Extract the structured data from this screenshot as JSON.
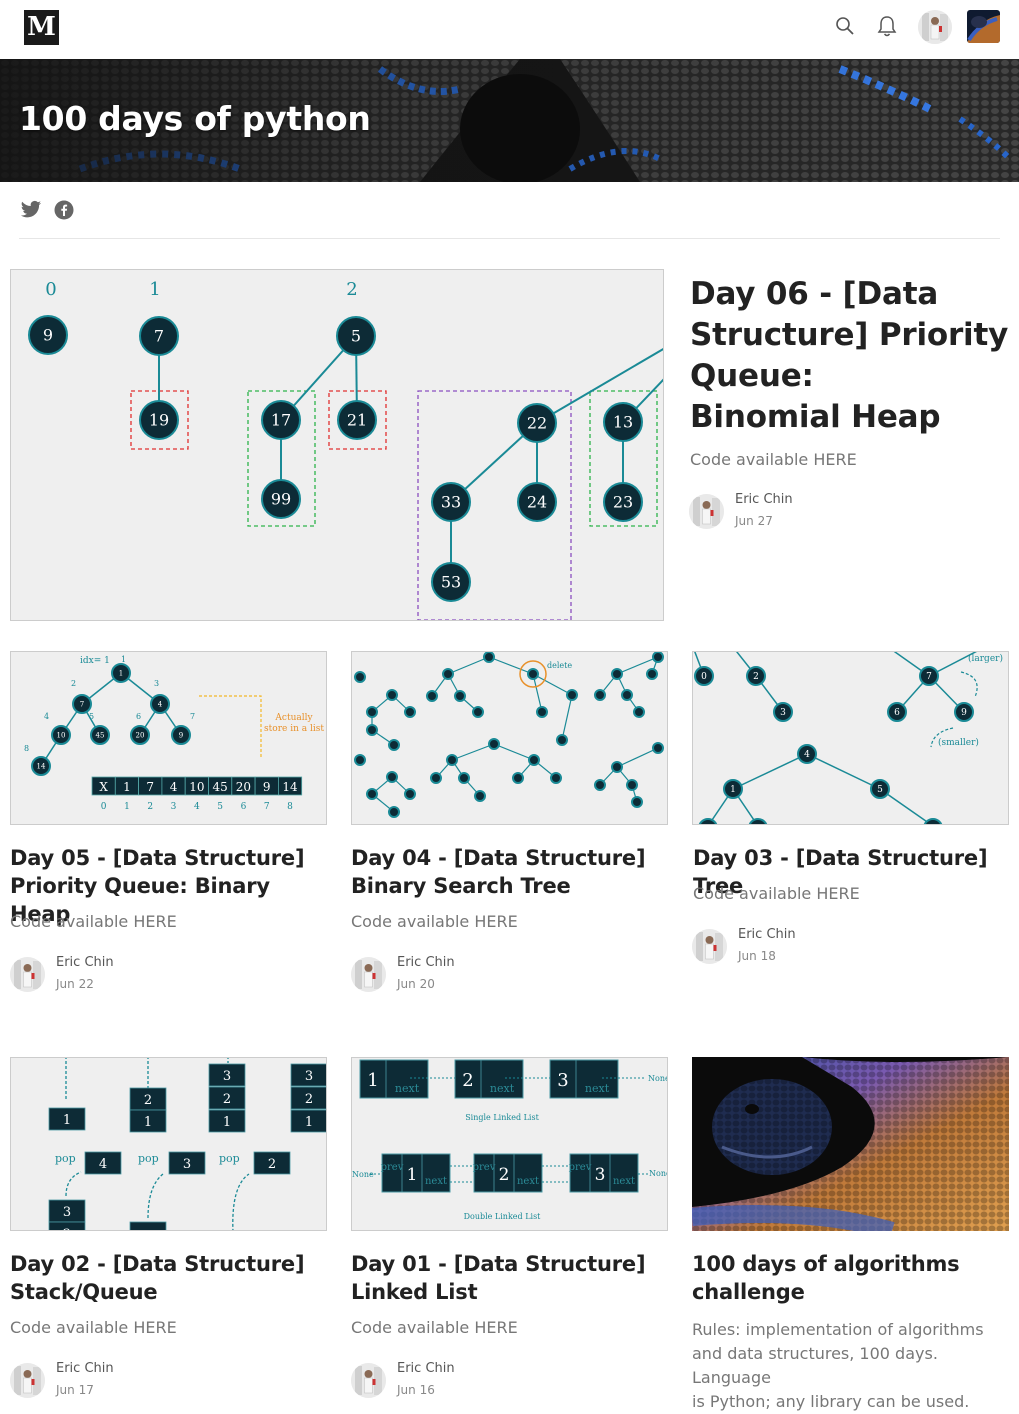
{
  "topbar": {
    "logo": "M",
    "icons": [
      "search-icon",
      "bell-icon"
    ]
  },
  "publication": {
    "title": "100 days of python"
  },
  "share": {
    "icons": [
      "twitter-icon",
      "facebook-icon"
    ]
  },
  "featured": {
    "title": "Day 06 - [Data Structure] Priority Queue: Binomial Heap",
    "title_lines": [
      "Day 06 - [Data",
      "Structure] Priority",
      "Queue:",
      "Binomial Heap"
    ],
    "subtitle": "Code available HERE",
    "author": "Eric Chin",
    "date": "Jun 27",
    "image": {
      "labels": [
        "0",
        "1",
        "2"
      ],
      "nodes": [
        "9",
        "7",
        "19",
        "5",
        "17",
        "21",
        "99",
        "22",
        "13",
        "33",
        "24",
        "23",
        "53"
      ]
    }
  },
  "cards": [
    {
      "title_lines": [
        "Day 05 - [Data Structure]",
        "Priority Queue: Binary Heap"
      ],
      "subtitle": "Code available HERE",
      "author": "Eric Chin",
      "date": "Jun 22",
      "image": {
        "idx_label": "idx= 1",
        "array": [
          "X",
          "1",
          "7",
          "4",
          "10",
          "45",
          "20",
          "9",
          "14"
        ],
        "indices": [
          "0",
          "1",
          "2",
          "3",
          "4",
          "5",
          "6",
          "7",
          "8"
        ],
        "note_line1": "Actually",
        "note_line2": "store in a list"
      }
    },
    {
      "title_lines": [
        "Day 04 - [Data Structure]",
        "Binary Search Tree"
      ],
      "subtitle": "Code available HERE",
      "author": "Eric Chin",
      "date": "Jun 20",
      "image": {
        "delete_label": "delete"
      }
    },
    {
      "title_lines": [
        "Day 03 - [Data Structure] Tree"
      ],
      "subtitle": "Code available HERE",
      "author": "Eric Chin",
      "date": "Jun 18",
      "image": {
        "larger_label": "(larger)",
        "smaller_label": "(smaller)",
        "nodes": [
          "0",
          "2",
          "3",
          "7",
          "6",
          "9",
          "4",
          "1",
          "5"
        ]
      }
    },
    {
      "title_lines": [
        "Day 02 - [Data Structure]",
        "Stack/Queue"
      ],
      "subtitle": "Code available HERE",
      "author": "Eric Chin",
      "date": "Jun 17",
      "image": {
        "pop_label": "pop"
      }
    },
    {
      "title_lines": [
        "Day 01 - [Data Structure]",
        "Linked List"
      ],
      "subtitle": "Code available HERE",
      "author": "Eric Chin",
      "date": "Jun 16",
      "image": {
        "single_label": "Single Linked List",
        "double_label": "Double Linked List",
        "none_label": "None",
        "next_label": "next",
        "prev_label": "prev"
      }
    },
    {
      "title_lines": [
        "100 days of algorithms",
        "challenge"
      ],
      "subtitle_lines": [
        "Rules: implementation of algorithms",
        "and data structures, 100 days. Language",
        "is Python; any library can be used."
      ]
    }
  ],
  "colors": {
    "node_fill": "#0d2b36",
    "node_stroke": "#1a8a96",
    "accent_teal": "#1a8a96",
    "red_dash": "#e03030",
    "green_dash": "#2db34a",
    "purple_dash": "#8a4fc0",
    "orange": "#e8912b"
  }
}
